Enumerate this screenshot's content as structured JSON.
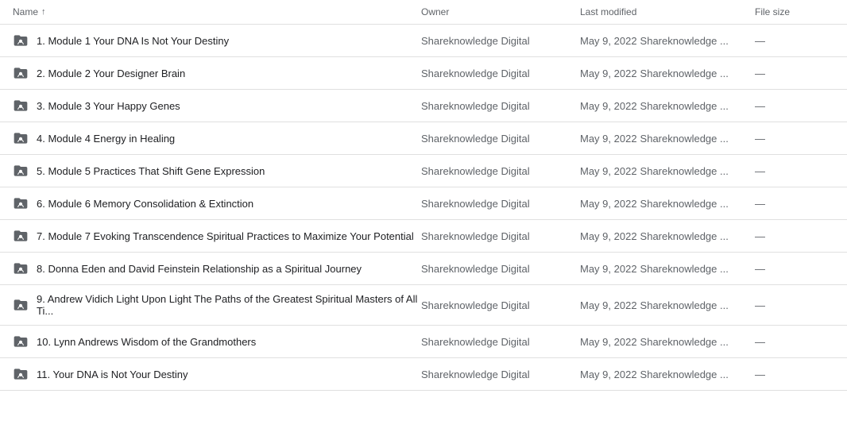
{
  "header": {
    "name_label": "Name",
    "sort_arrow": "↑",
    "owner_label": "Owner",
    "modified_label": "Last modified",
    "size_label": "File size"
  },
  "rows": [
    {
      "id": 1,
      "name": "1. Module 1 Your DNA Is Not Your Destiny",
      "owner": "Shareknowledge Digital",
      "modified_date": "May 9, 2022",
      "modified_user": "Shareknowledge ...",
      "size": "—"
    },
    {
      "id": 2,
      "name": "2. Module 2 Your Designer Brain",
      "owner": "Shareknowledge Digital",
      "modified_date": "May 9, 2022",
      "modified_user": "Shareknowledge ...",
      "size": "—"
    },
    {
      "id": 3,
      "name": "3. Module 3 Your Happy Genes",
      "owner": "Shareknowledge Digital",
      "modified_date": "May 9, 2022",
      "modified_user": "Shareknowledge ...",
      "size": "—"
    },
    {
      "id": 4,
      "name": "4. Module 4 Energy in Healing",
      "owner": "Shareknowledge Digital",
      "modified_date": "May 9, 2022",
      "modified_user": "Shareknowledge ...",
      "size": "—"
    },
    {
      "id": 5,
      "name": "5. Module 5 Practices That Shift Gene Expression",
      "owner": "Shareknowledge Digital",
      "modified_date": "May 9, 2022",
      "modified_user": "Shareknowledge ...",
      "size": "—"
    },
    {
      "id": 6,
      "name": "6. Module 6 Memory Consolidation & Extinction",
      "owner": "Shareknowledge Digital",
      "modified_date": "May 9, 2022",
      "modified_user": "Shareknowledge ...",
      "size": "—"
    },
    {
      "id": 7,
      "name": "7. Module 7 Evoking Transcendence Spiritual Practices to Maximize Your Potential",
      "owner": "Shareknowledge Digital",
      "modified_date": "May 9, 2022",
      "modified_user": "Shareknowledge ...",
      "size": "—"
    },
    {
      "id": 8,
      "name": "8. Donna Eden and David Feinstein Relationship as a Spiritual Journey",
      "owner": "Shareknowledge Digital",
      "modified_date": "May 9, 2022",
      "modified_user": "Shareknowledge ...",
      "size": "—"
    },
    {
      "id": 9,
      "name": "9. Andrew Vidich Light Upon Light The Paths of the Greatest Spiritual Masters of All Ti...",
      "owner": "Shareknowledge Digital",
      "modified_date": "May 9, 2022",
      "modified_user": "Shareknowledge ...",
      "size": "—"
    },
    {
      "id": 10,
      "name": "10. Lynn Andrews Wisdom of the Grandmothers",
      "owner": "Shareknowledge Digital",
      "modified_date": "May 9, 2022",
      "modified_user": "Shareknowledge ...",
      "size": "—"
    },
    {
      "id": 11,
      "name": "11. Your DNA is Not Your Destiny",
      "owner": "Shareknowledge Digital",
      "modified_date": "May 9, 2022",
      "modified_user": "Shareknowledge ...",
      "size": "—"
    }
  ]
}
